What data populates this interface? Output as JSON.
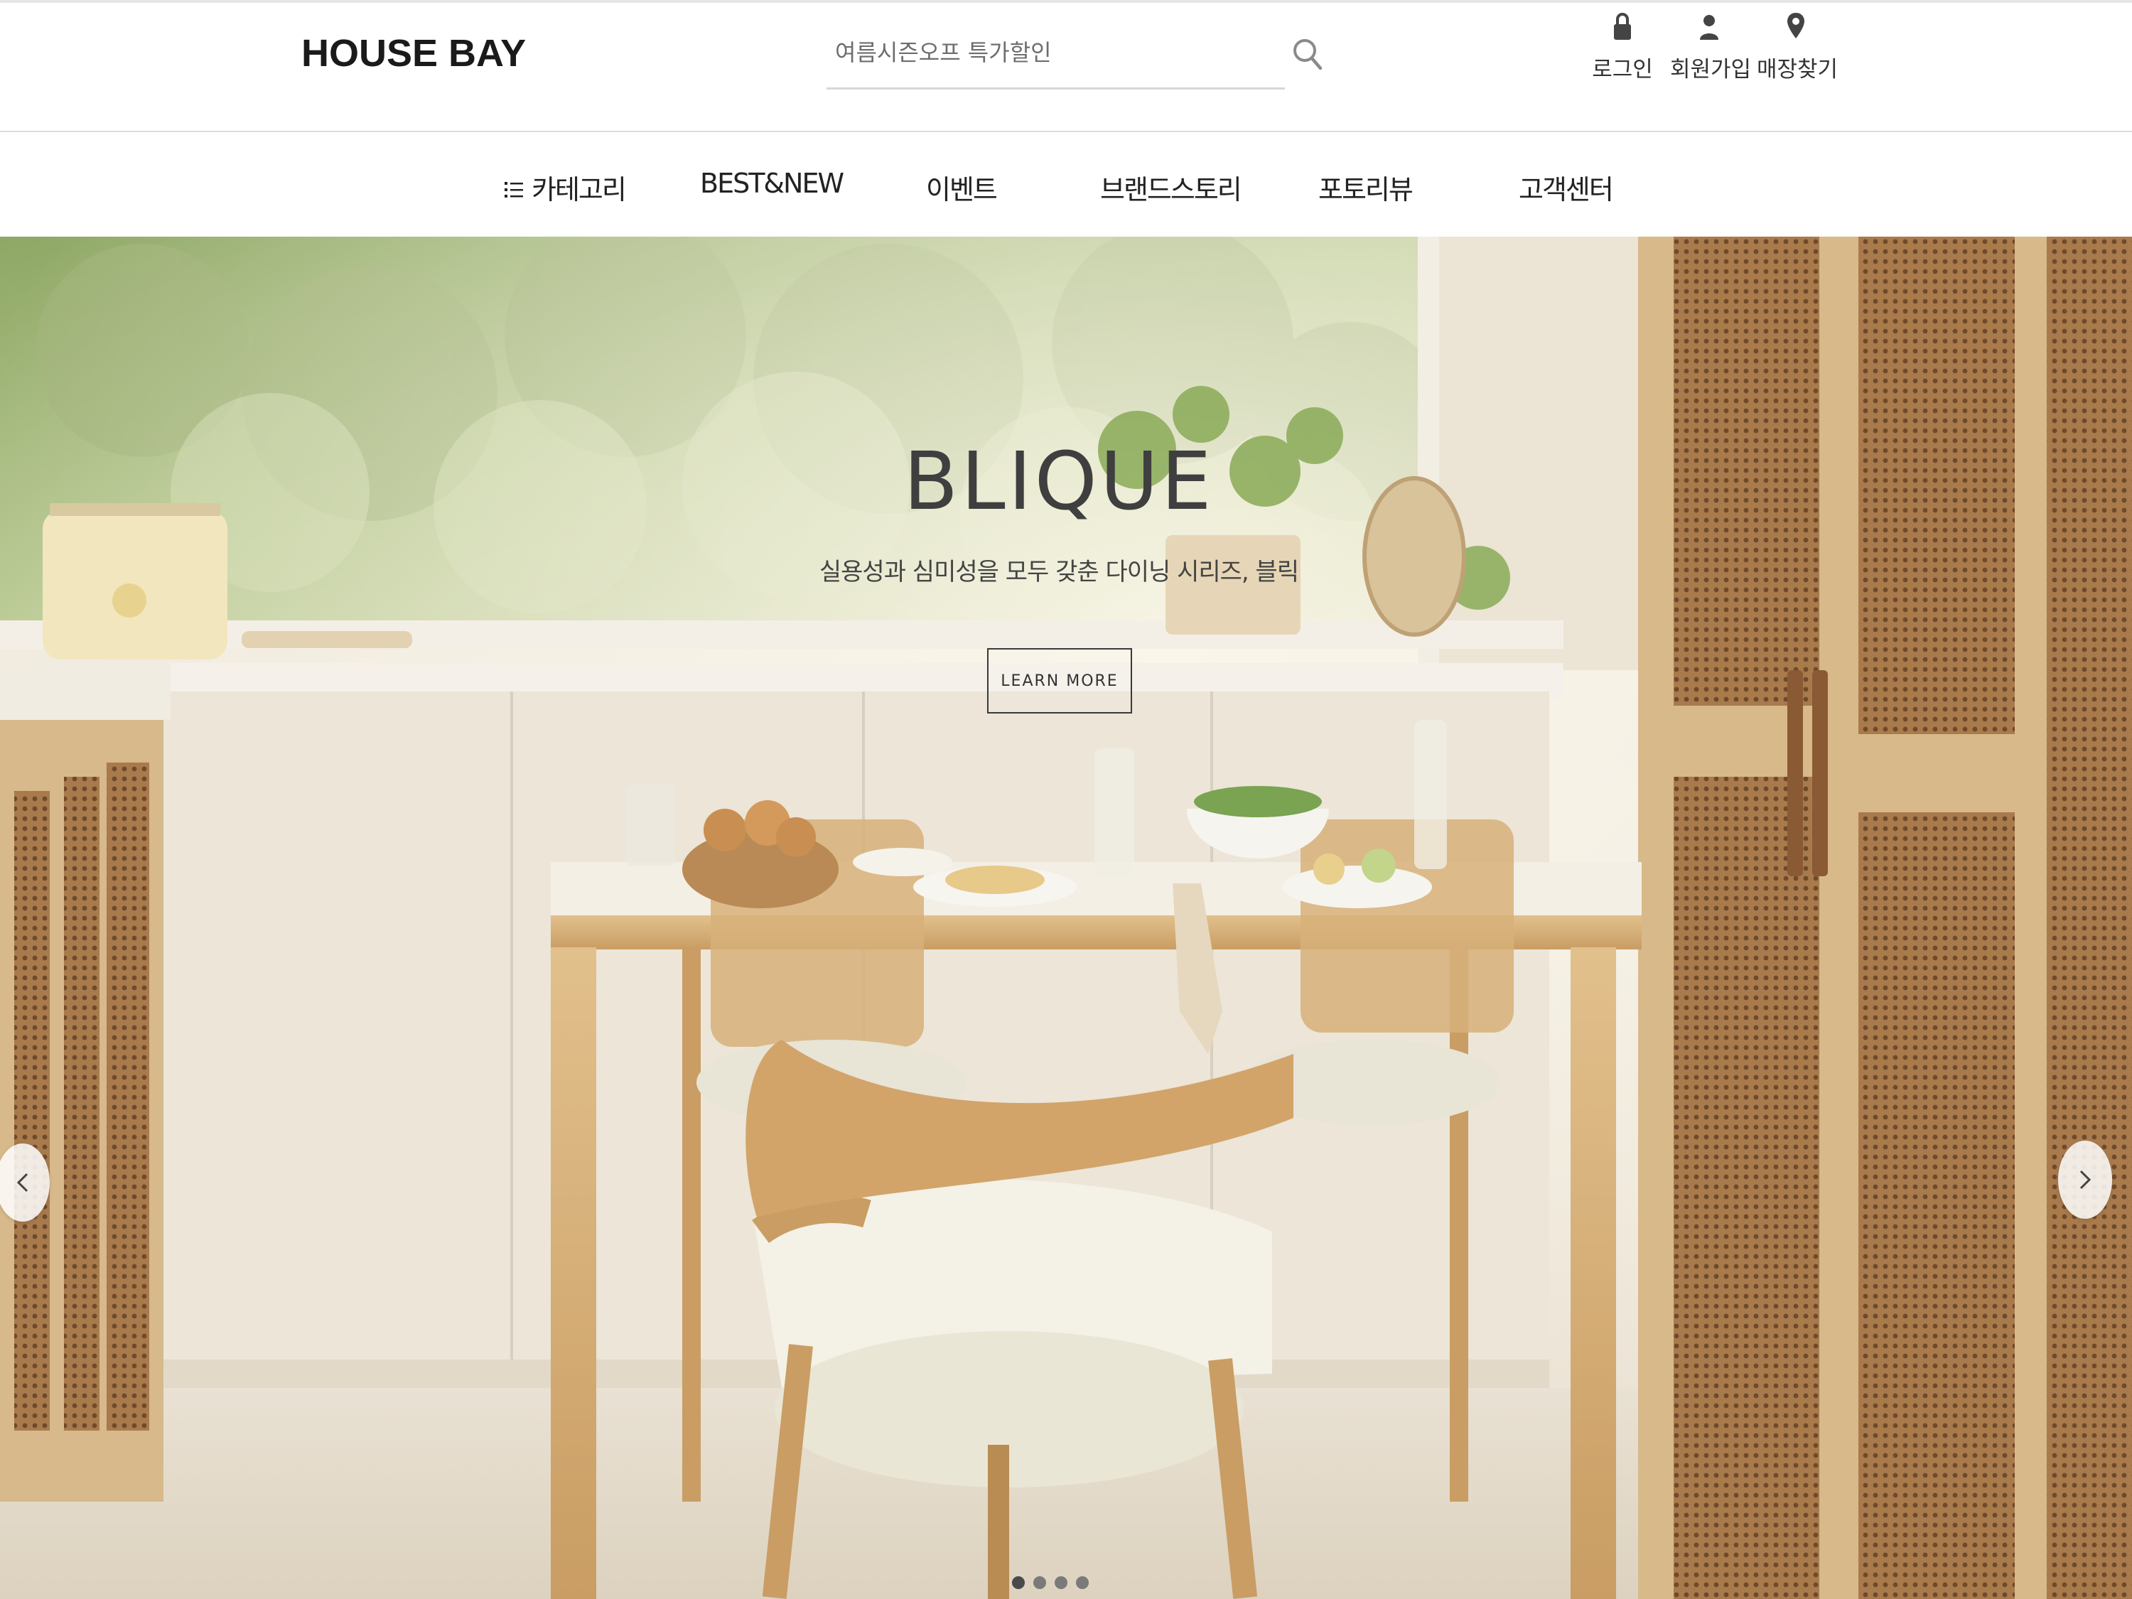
{
  "brand": {
    "logo_text": "HOUSE BAY"
  },
  "search": {
    "placeholder": "여름시즌오프 특가할인",
    "icon": "search-icon"
  },
  "utility_links": [
    {
      "label": "로그인",
      "icon": "lock-icon"
    },
    {
      "label": "회원가입",
      "icon": "person-icon"
    },
    {
      "label": "매장찾기",
      "icon": "map-pin-icon"
    }
  ],
  "nav": {
    "items": [
      {
        "label": "카테고리",
        "icon": "menu-list-icon"
      },
      {
        "label": "BEST&NEW"
      },
      {
        "label": "이벤트"
      },
      {
        "label": "브랜드스토리"
      },
      {
        "label": "포토리뷰"
      },
      {
        "label": "고객센터"
      }
    ]
  },
  "hero": {
    "title": "BLIQUE",
    "subtitle": "실용성과 심미성을 모두 갖춘 다이닝 시리즈, 블릭",
    "button_label": "LEARN MORE",
    "slide_count": 4,
    "active_slide": 1,
    "prev_icon": "chevron-left-icon",
    "next_icon": "chevron-right-icon"
  },
  "colors": {
    "text_dark": "#222222",
    "hero_wall": "#efe8dc",
    "wood": "#d8b47c",
    "rattan": "#b88a5a"
  }
}
